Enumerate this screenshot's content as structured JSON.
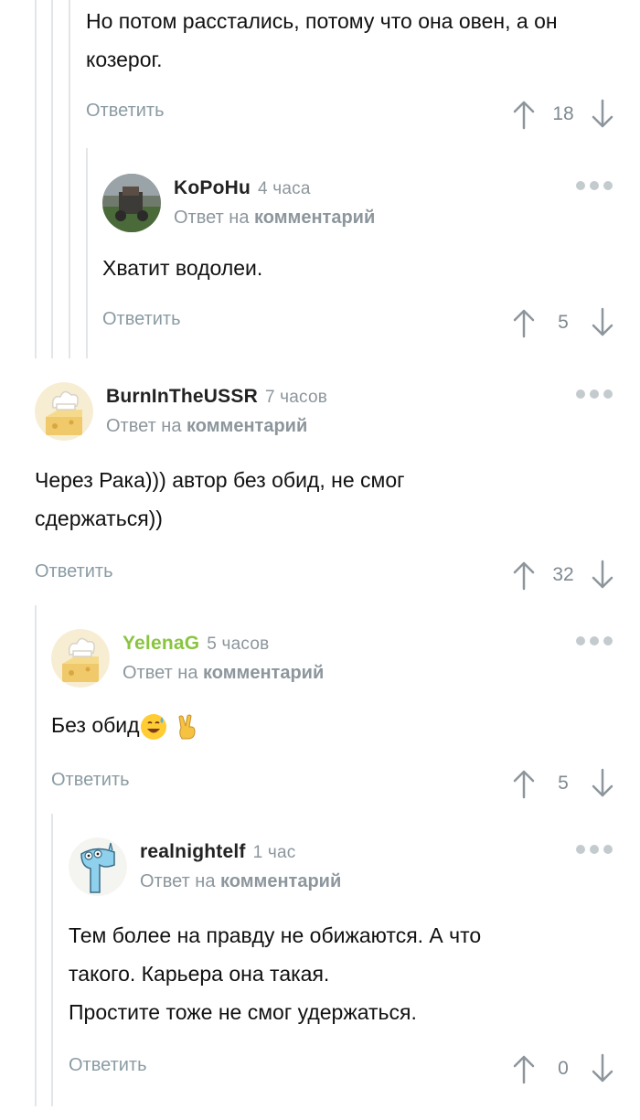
{
  "thread": {
    "top_text": "Но потом расстались, потому что она овен, а он козерог.",
    "top_reply": "Ответить",
    "top_votes": "18"
  },
  "comments": [
    {
      "username": "KoPoHu",
      "time": "4 часа",
      "reply_prefix": "Ответ на",
      "reply_link": "комментарий",
      "text": "Хватит водолеи.",
      "reply": "Ответить",
      "votes": "5",
      "avatar_icon": "photo-avatar-icon"
    },
    {
      "username": "BurnInTheUSSR",
      "time": "7 часов",
      "reply_prefix": "Ответ на",
      "reply_link": "комментарий",
      "text_lines": [
        "Через Рака))) автор без обид, не смог",
        "сдержаться))"
      ],
      "reply": "Ответить",
      "votes": "32",
      "avatar_icon": "cheese-chef-avatar-icon"
    },
    {
      "username": "YelenaG",
      "time": "5 часов",
      "reply_prefix": "Ответ на",
      "reply_link": "комментарий",
      "text": "Без обид",
      "reply": "Ответить",
      "votes": "5",
      "avatar_icon": "cheese-chef-avatar-icon",
      "username_color": "#8ac440"
    },
    {
      "username": "realnightelf",
      "time": "1 час",
      "reply_prefix": "Ответ на",
      "reply_link": "комментарий",
      "text_lines": [
        "Тем более на правду не обижаются. А что",
        "такого. Карьера она такая.",
        "Простите тоже не смог удержаться."
      ],
      "reply": "Ответить",
      "votes": "0",
      "avatar_icon": "blue-creature-avatar-icon"
    }
  ],
  "colors": {
    "thread_line": "#e3e6e8",
    "meta_gray": "#8c969c",
    "reply_gray": "#8a9ba3",
    "green_user": "#8ac440"
  }
}
